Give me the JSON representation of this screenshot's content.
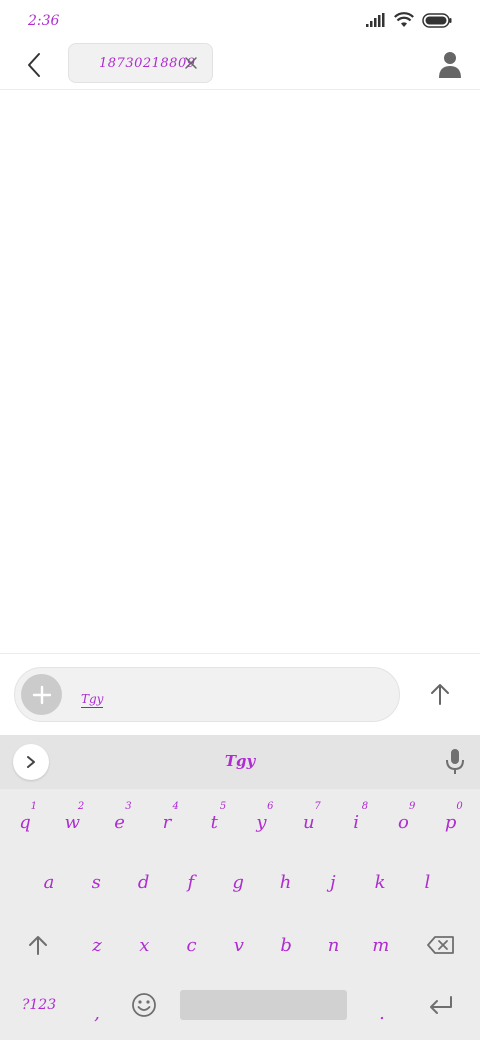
{
  "status_bar": {
    "time": "2:36"
  },
  "header": {
    "recipient": "18730218809"
  },
  "compose": {
    "text": "Tgy"
  },
  "keyboard": {
    "suggestion": "Tgy",
    "row1": [
      {
        "key": "q",
        "hint": "1"
      },
      {
        "key": "w",
        "hint": "2"
      },
      {
        "key": "e",
        "hint": "3"
      },
      {
        "key": "r",
        "hint": "4"
      },
      {
        "key": "t",
        "hint": "5"
      },
      {
        "key": "y",
        "hint": "6"
      },
      {
        "key": "u",
        "hint": "7"
      },
      {
        "key": "i",
        "hint": "8"
      },
      {
        "key": "o",
        "hint": "9"
      },
      {
        "key": "p",
        "hint": "0"
      }
    ],
    "row2": [
      "a",
      "s",
      "d",
      "f",
      "g",
      "h",
      "j",
      "k",
      "l"
    ],
    "row3": [
      "z",
      "x",
      "c",
      "v",
      "b",
      "n",
      "m"
    ],
    "symbols_label": "?123",
    "comma": ",",
    "period": "."
  },
  "colors": {
    "accent": "#b02bd1",
    "keyboard_bg": "#ececec",
    "icon_gray": "#6f6f6f"
  },
  "icons": {
    "back": "chevron-left-icon",
    "chip_close": "close-icon",
    "contact": "person-icon",
    "attach": "plus-icon",
    "send": "arrow-up-icon",
    "expand": "chevron-right-icon",
    "mic": "mic-icon",
    "shift": "shift-icon",
    "backspace": "backspace-icon",
    "emoji": "emoji-icon",
    "enter": "enter-icon"
  }
}
